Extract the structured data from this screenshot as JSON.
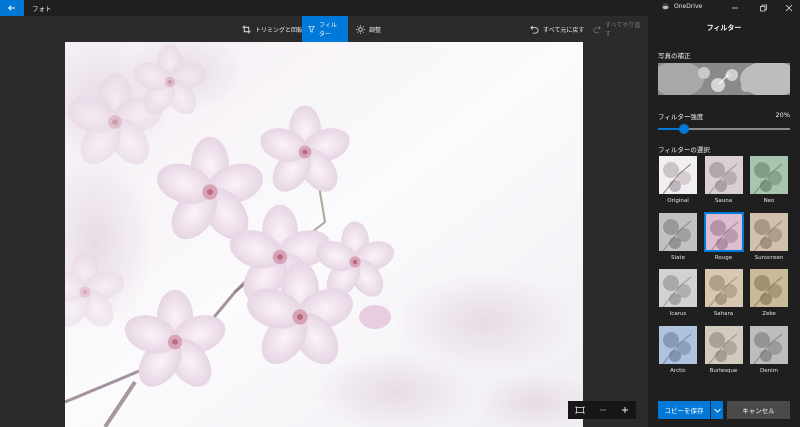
{
  "titlebar": {
    "app_title": "フォト",
    "account": "OneDrive"
  },
  "toolbar": {
    "crop_rotate": "トリミングと回転",
    "filter": "フィルター",
    "adjust": "調整",
    "undo_all": "すべて元に戻す",
    "redo_all": "すべてやり直す"
  },
  "panel": {
    "title": "フィルター",
    "enhance_label": "写真の補正",
    "strength_label": "フィルター強度",
    "strength_value": "20%",
    "strength_fraction": 0.2,
    "select_label": "フィルターの選択",
    "filters": [
      {
        "name": "Original",
        "tint": "none"
      },
      {
        "name": "Sauna",
        "tint": "#c9b7bd"
      },
      {
        "name": "Neo",
        "tint": "#5fa070"
      },
      {
        "name": "Slate",
        "tint": "#9a9a9a"
      },
      {
        "name": "Rouge",
        "tint": "#d58fb9"
      },
      {
        "name": "Sunscreen",
        "tint": "#b8946a"
      },
      {
        "name": "Icarus",
        "tint": "#bdbdbd"
      },
      {
        "name": "Sahara",
        "tint": "#c9a676"
      },
      {
        "name": "Zeke",
        "tint": "#a98a3c"
      },
      {
        "name": "Arctic",
        "tint": "#6f99d6"
      },
      {
        "name": "Burlesque",
        "tint": "#b8ad8d"
      },
      {
        "name": "Denim",
        "tint": "#8f8f8f"
      }
    ],
    "selected_filter": "Rouge",
    "save_label": "コピーを保存",
    "cancel_label": "キャンセル"
  },
  "colors": {
    "accent": "#0078d7",
    "panel_bg": "#1f1f1f",
    "canvas_bg": "#2b2b2b"
  }
}
